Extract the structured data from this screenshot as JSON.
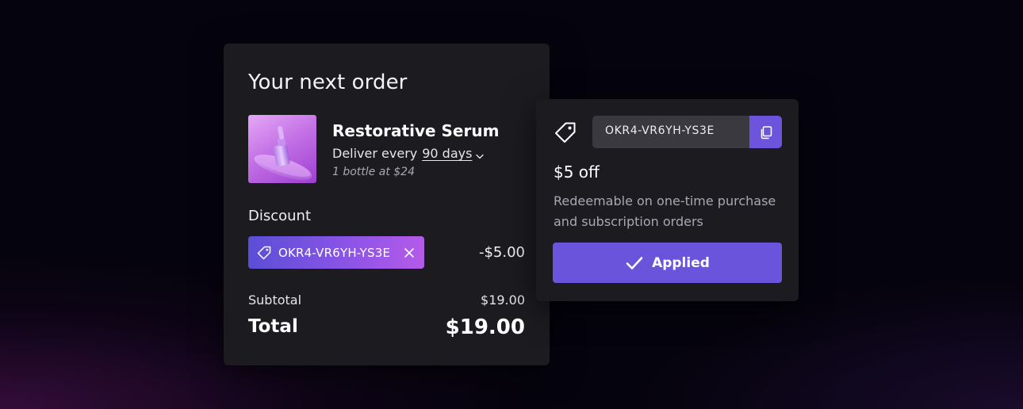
{
  "order": {
    "title": "Your next order",
    "product": {
      "name": "Restorative Serum",
      "deliver_prefix": "Deliver every",
      "frequency": "90 days",
      "quantity_line": "1 bottle at $24"
    },
    "discount": {
      "label": "Discount",
      "code": "OKR4-VR6YH-YS3E",
      "amount": "-$5.00"
    },
    "subtotal": {
      "label": "Subtotal",
      "value": "$19.00"
    },
    "total": {
      "label": "Total",
      "value": "$19.00"
    }
  },
  "coupon": {
    "code": "OKR4-VR6YH-YS3E",
    "title": "$5 off",
    "description": "Redeemable on one-time purchase and subscription orders",
    "button_label": "Applied"
  },
  "icons": {
    "tag": "tag-icon",
    "copy": "copy-icon",
    "check": "check-icon",
    "close": "close-icon",
    "chevron": "chevron-down-icon"
  },
  "colors": {
    "accent": "#6b54dc",
    "card_bg": "#1c1b20",
    "chip_gradient_start": "#5b4ed6",
    "chip_gradient_end": "#b55ae8",
    "muted_text": "#a9a8b2"
  }
}
